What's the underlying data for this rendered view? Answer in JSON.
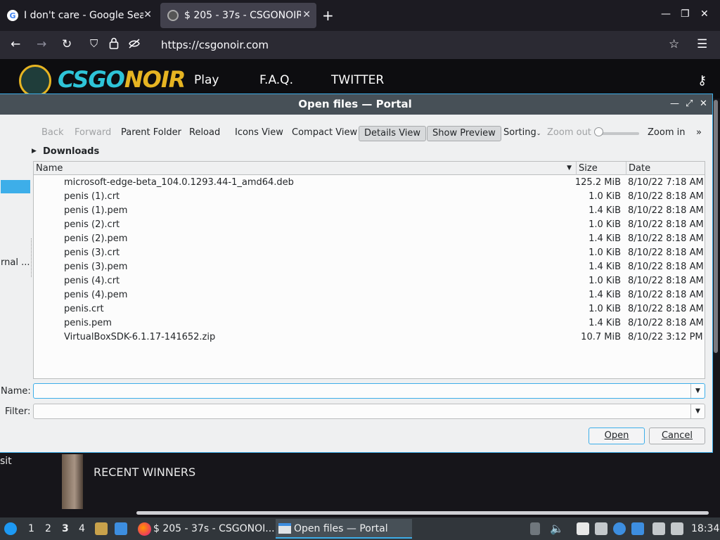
{
  "browser": {
    "tabs": [
      {
        "title": "I don't care - Google Search",
        "favicon": "G"
      },
      {
        "title": "$ 205 - 37s - CSGONOIR",
        "favicon": ""
      }
    ],
    "new_tab": "+",
    "url": "https://csgonoir.com"
  },
  "site": {
    "logo_a": "CSGO",
    "logo_b": "NOIR",
    "nav": [
      "Play",
      "F.A.Q.",
      "TWITTER"
    ],
    "recent_winners": "RECENT WINNERS",
    "left_fragment": "sit"
  },
  "dialog": {
    "title": "Open files — Portal",
    "toolbar": {
      "back": "Back",
      "forward": "Forward",
      "parent": "Parent Folder",
      "reload": "Reload",
      "icons_view": "Icons View",
      "compact_view": "Compact View",
      "details_view": "Details View",
      "show_preview": "Show Preview",
      "sorting": "Sorting",
      "zoom_out": "Zoom out",
      "zoom_in": "Zoom in",
      "more": "»"
    },
    "breadcrumb": "Downloads",
    "side_label": "rnal ...",
    "columns": {
      "name": "Name",
      "size": "Size",
      "date": "Date"
    },
    "files": [
      {
        "name": "microsoft-edge-beta_104.0.1293.44-1_amd64.deb",
        "size": "125.2 MiB",
        "date": "8/10/22 7:18 AM"
      },
      {
        "name": "penis (1).crt",
        "size": "1.0 KiB",
        "date": "8/10/22 8:18 AM"
      },
      {
        "name": "penis (1).pem",
        "size": "1.4 KiB",
        "date": "8/10/22 8:18 AM"
      },
      {
        "name": "penis (2).crt",
        "size": "1.0 KiB",
        "date": "8/10/22 8:18 AM"
      },
      {
        "name": "penis (2).pem",
        "size": "1.4 KiB",
        "date": "8/10/22 8:18 AM"
      },
      {
        "name": "penis (3).crt",
        "size": "1.0 KiB",
        "date": "8/10/22 8:18 AM"
      },
      {
        "name": "penis (3).pem",
        "size": "1.4 KiB",
        "date": "8/10/22 8:18 AM"
      },
      {
        "name": "penis (4).crt",
        "size": "1.0 KiB",
        "date": "8/10/22 8:18 AM"
      },
      {
        "name": "penis (4).pem",
        "size": "1.4 KiB",
        "date": "8/10/22 8:18 AM"
      },
      {
        "name": "penis.crt",
        "size": "1.0 KiB",
        "date": "8/10/22 8:18 AM"
      },
      {
        "name": "penis.pem",
        "size": "1.4 KiB",
        "date": "8/10/22 8:18 AM"
      },
      {
        "name": "VirtualBoxSDK-6.1.17-141652.zip",
        "size": "10.7 MiB",
        "date": "8/10/22 3:12 PM"
      }
    ],
    "name_label": "Name:",
    "name_value": "",
    "filter_label": "Filter:",
    "filter_value": "",
    "open": "Open",
    "cancel": "Cancel"
  },
  "taskbar": {
    "desktops": [
      "1",
      "2",
      "3",
      "4"
    ],
    "active_desktop": "3",
    "windows": [
      {
        "title": "$ 205 - 37s - CSGONOI..."
      },
      {
        "title": "Open files — Portal"
      }
    ],
    "clock": "18:34"
  },
  "colors": {
    "accent": "#3daee9",
    "titlebar": "#475057",
    "logo_cyan": "#2ec4d8",
    "logo_gold": "#e6b422"
  }
}
